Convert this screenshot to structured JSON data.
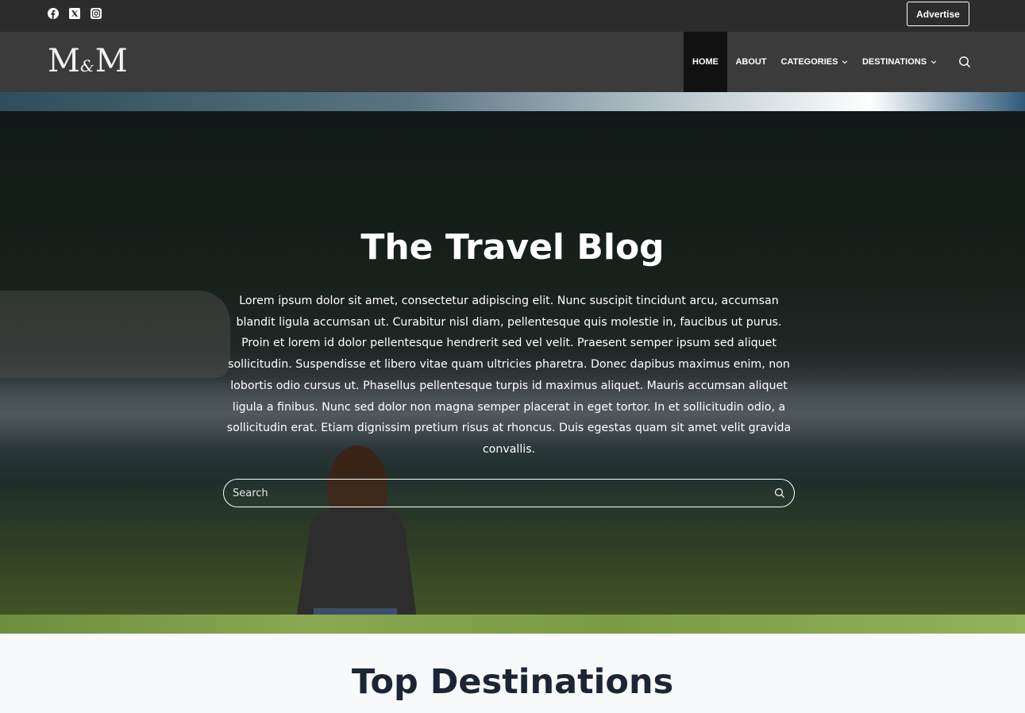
{
  "topbar": {
    "social": [
      {
        "name": "facebook-icon"
      },
      {
        "name": "x-icon"
      },
      {
        "name": "instagram-icon"
      }
    ],
    "advertise_label": "Advertise"
  },
  "header": {
    "logo": {
      "left": "M",
      "amp": "&",
      "right": "M"
    },
    "nav": {
      "home": "HOME",
      "about": "ABOUT",
      "categories": "CATEGORIES",
      "destinations": "DESTINATIONS"
    },
    "active": "HOME"
  },
  "hero": {
    "title": "The Travel Blog",
    "text": "Lorem ipsum dolor sit amet, consectetur adipiscing elit. Nunc suscipit tincidunt arcu, accumsan blandit ligula accumsan ut. Curabitur nisl diam, pellentesque quis molestie in, faucibus ut purus. Proin et lorem id dolor pellentesque hendrerit sed vel velit. Praesent semper ipsum sed aliquet sollicitudin. Suspendisse et libero vitae quam ultricies pharetra. Donec dapibus maximus enim, non lobortis odio cursus ut. Phasellus pellentesque turpis id maximus aliquet. Mauris accumsan aliquet ligula a finibus. Nunc sed dolor non magna semper placerat in eget tortor. In et sollicitudin odio, a sollicitudin erat. Etiam dignissim pretium risus at rhoncus. Duis egestas quam sit amet velit gravida convallis.",
    "search_placeholder": "Search"
  },
  "section": {
    "title": "Top Destinations"
  },
  "colors": {
    "topbar": "#2c2c2c",
    "header": "#3b3b3b",
    "nav_active": "#111111",
    "section_bg": "#f8f9fb",
    "section_title": "#1b2534"
  }
}
